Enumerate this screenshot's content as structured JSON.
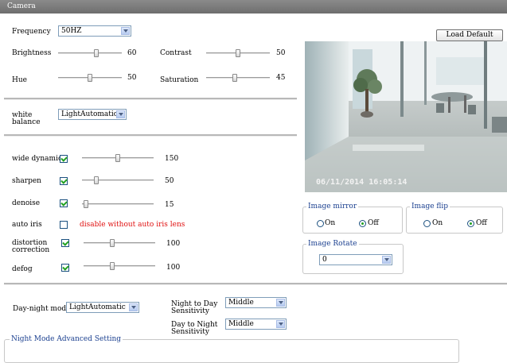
{
  "title": "Camera",
  "load_default": "Load Default",
  "frequency": {
    "label": "Frequency",
    "value": "50HZ"
  },
  "brightness": {
    "label": "Brightness",
    "value": "60",
    "level": 60
  },
  "contrast": {
    "label": "Contrast",
    "value": "50",
    "level": 50
  },
  "hue": {
    "label": "Hue",
    "value": "50",
    "level": 50
  },
  "saturation": {
    "label": "Saturation",
    "value": "45",
    "level": 45
  },
  "white_balance": {
    "label_line1": "white",
    "label_line2": "balance",
    "value": "LightAutomatic"
  },
  "wide_dynamic": {
    "label": "wide dynamic",
    "checked": true,
    "value": "150",
    "level": 50
  },
  "sharpen": {
    "label": "sharpen",
    "checked": true,
    "value": "50",
    "level": 20
  },
  "denoise": {
    "label": "denoise",
    "checked": true,
    "value": "15",
    "level": 5
  },
  "auto_iris": {
    "label": "auto iris",
    "checked": false,
    "note": "disable without auto iris lens"
  },
  "distortion": {
    "label_line1": "distortion",
    "label_line2": "correction",
    "checked": true,
    "value": "100",
    "level": 40
  },
  "defog": {
    "label": "defog",
    "checked": true,
    "value": "100",
    "level": 40
  },
  "video": {
    "timestamp": "06/11/2014 16:05:14"
  },
  "image_mirror": {
    "legend": "Image mirror",
    "on": "On",
    "off": "Off",
    "selected": "Off"
  },
  "image_flip": {
    "legend": "Image flip",
    "on": "On",
    "off": "Off",
    "selected": "Off"
  },
  "image_rotate": {
    "legend": "Image Rotate",
    "value": "0"
  },
  "day_night": {
    "label": "Day-night mode",
    "value": "LightAutomatic"
  },
  "night_to_day": {
    "label_line1": "Night to Day",
    "label_line2": "Sensitivity",
    "value": "Middle"
  },
  "day_to_night": {
    "label_line1": "Day to Night",
    "label_line2": "Sensitivity",
    "value": "Middle"
  },
  "night_mode": {
    "legend": "Night Mode Advanced Setting"
  },
  "colors": {
    "accent": "#1a3f8f",
    "warning": "#e01010",
    "check": "#21a121",
    "titlebar": "#7a7a7a"
  }
}
